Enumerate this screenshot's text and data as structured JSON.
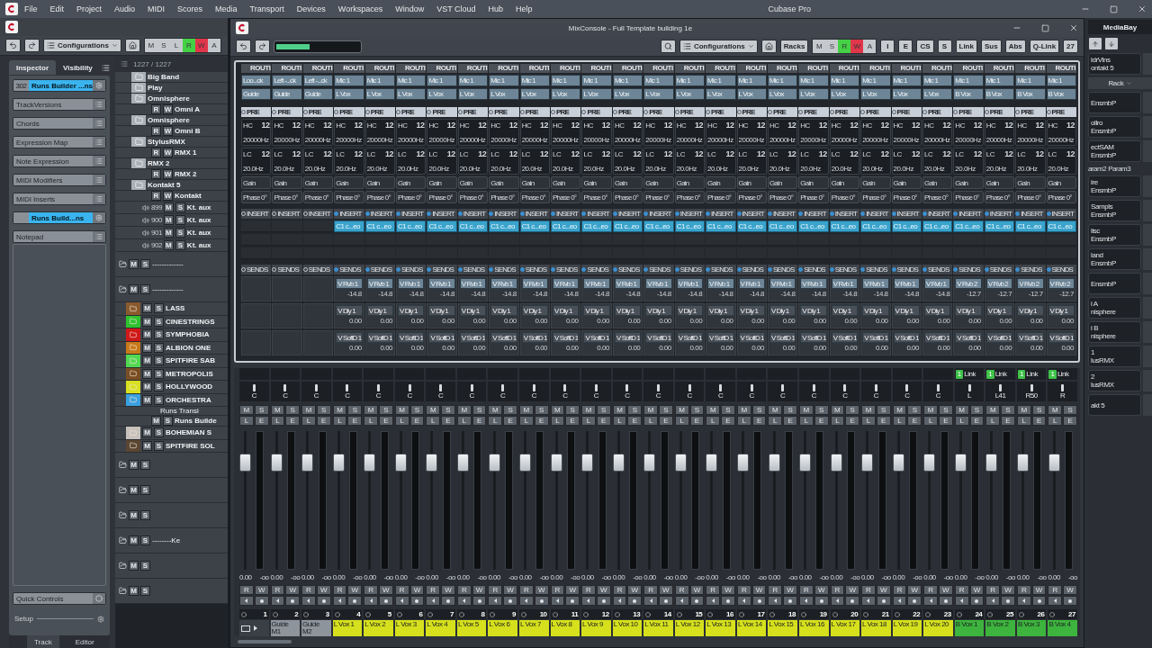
{
  "menu": {
    "items": [
      "File",
      "Edit",
      "Project",
      "Audio",
      "MIDI",
      "Scores",
      "Media",
      "Transport",
      "Devices",
      "Workspaces",
      "Window",
      "VST Cloud",
      "Hub",
      "Help"
    ],
    "title": "Cubase Pro"
  },
  "project": {
    "toolbar": {
      "config": "Configurations",
      "modes": [
        {
          "label": "M",
          "on": false
        },
        {
          "label": "S",
          "on": false
        },
        {
          "label": "L",
          "on": false
        },
        {
          "label": "R",
          "on": true,
          "color": "#45d145"
        },
        {
          "label": "W",
          "on": true,
          "color": "#e0364a"
        },
        {
          "label": "A",
          "on": false
        }
      ]
    },
    "tabs": [
      {
        "label": "Inspector",
        "selected": true
      },
      {
        "label": "Visibility",
        "selected": false
      }
    ],
    "inspector": [
      {
        "kind": "track",
        "number": "302",
        "label": "Runs Builder ...ns"
      },
      {
        "kind": "section",
        "label": "TrackVersions"
      },
      {
        "kind": "section",
        "label": "Chords"
      },
      {
        "kind": "section",
        "label": "Expression Map"
      },
      {
        "kind": "section",
        "label": "Note Expression"
      },
      {
        "kind": "section",
        "label": "MIDI Modifiers"
      },
      {
        "kind": "section",
        "label": "MIDI Inserts"
      },
      {
        "kind": "track",
        "label": "Runs Build...ns"
      },
      {
        "kind": "section",
        "label": "Notepad"
      }
    ],
    "quick_controls": "Quick Controls",
    "setup": "Setup",
    "track_count": "1227 / 1227",
    "tracks": [
      {
        "kind": "folder",
        "name": "Big Band"
      },
      {
        "kind": "folder",
        "name": "Play"
      },
      {
        "kind": "folder",
        "name": "Omnisphere",
        "children": [
          {
            "kind": "instrument",
            "name": "Omni A",
            "buttons": [
              "R",
              "W"
            ]
          }
        ]
      },
      {
        "kind": "folder",
        "name": "Omnisphere",
        "children": [
          {
            "kind": "instrument",
            "name": "Omni B",
            "buttons": [
              "R",
              "W"
            ]
          }
        ]
      },
      {
        "kind": "folder",
        "name": "StylusRMX",
        "children": [
          {
            "kind": "instrument",
            "name": "RMX 1",
            "buttons": [
              "R",
              "W"
            ]
          }
        ]
      },
      {
        "kind": "folder",
        "name": "RMX 2",
        "children": [
          {
            "kind": "instrument",
            "name": "RMX 2",
            "buttons": [
              "R",
              "W"
            ]
          }
        ]
      },
      {
        "kind": "folder",
        "name": "Kontakt 5",
        "children": [
          {
            "kind": "instrument",
            "name": "Kontakt",
            "buttons": [
              "R",
              "W"
            ]
          },
          {
            "kind": "output",
            "number": "899",
            "name": "Kt. aux",
            "buttons": [
              "M",
              "S"
            ]
          },
          {
            "kind": "output",
            "number": "900",
            "name": "Kt. aux",
            "buttons": [
              "M",
              "S"
            ]
          },
          {
            "kind": "output",
            "number": "901",
            "name": "Kt. aux",
            "buttons": [
              "M",
              "S"
            ]
          },
          {
            "kind": "output",
            "number": "902",
            "name": "Kt. aux",
            "buttons": [
              "M",
              "S"
            ]
          }
        ]
      },
      {
        "kind": "group",
        "name": "-------------",
        "buttons": [
          "M",
          "S"
        ]
      },
      {
        "kind": "group",
        "name": "-------------",
        "buttons": [
          "M",
          "S"
        ]
      },
      {
        "kind": "colored",
        "name": "LASS",
        "color": "#8a5a2e",
        "buttons": [
          "M",
          "S"
        ]
      },
      {
        "kind": "colored",
        "name": "CINESTRINGS",
        "color": "#2fc42f",
        "buttons": [
          "M",
          "S"
        ]
      },
      {
        "kind": "colored",
        "name": "SYMPHOBIA",
        "color": "#d01818",
        "buttons": [
          "M",
          "S"
        ]
      },
      {
        "kind": "colored",
        "name": "ALBION ONE",
        "color": "#c87a1a",
        "buttons": [
          "M",
          "S"
        ]
      },
      {
        "kind": "colored",
        "name": "SPITFIRE SAB",
        "color": "#52d852",
        "buttons": [
          "M",
          "S"
        ]
      },
      {
        "kind": "colored",
        "name": "METROPOLIS",
        "color": "#7a4e22",
        "buttons": [
          "M",
          "S"
        ]
      },
      {
        "kind": "colored",
        "name": "HOLLYWOOD",
        "color": "#d8e020",
        "buttons": [
          "M",
          "S"
        ]
      },
      {
        "kind": "colored",
        "name": "ORCHESTRA",
        "color": "#3aa0e0",
        "buttons": [
          "M",
          "S"
        ],
        "children": [
          {
            "kind": "label",
            "name": "Runs Transi"
          },
          {
            "kind": "instrument",
            "name": "Runs Builde",
            "buttons": [
              "M",
              "S"
            ]
          }
        ]
      },
      {
        "kind": "colored",
        "name": "BOHEMIAN S",
        "color": "#c8c2bc",
        "buttons": [
          "M",
          "S"
        ]
      },
      {
        "kind": "colored",
        "name": "SPITFIRE SOL",
        "color": "#5a4632",
        "buttons": [
          "M",
          "S"
        ]
      },
      {
        "kind": "group",
        "buttons": [
          "M",
          "S"
        ]
      },
      {
        "kind": "group",
        "buttons": [
          "M",
          "S"
        ]
      },
      {
        "kind": "group",
        "buttons": [
          "M",
          "S"
        ]
      },
      {
        "kind": "group",
        "name": "--------Ke",
        "buttons": [
          "M",
          "S"
        ]
      },
      {
        "kind": "group",
        "buttons": [
          "M",
          "S"
        ]
      },
      {
        "kind": "group",
        "buttons": [
          "M",
          "S"
        ]
      }
    ],
    "bottom_tabs": [
      {
        "label": "Track",
        "selected": true
      },
      {
        "label": "Editor",
        "selected": false
      }
    ]
  },
  "mixconsole": {
    "title": "MixConsole - Full Template building 1e",
    "toolbar": {
      "config": "Configurations",
      "racks": "Racks",
      "modes": [
        {
          "label": "M",
          "on": false
        },
        {
          "label": "S",
          "on": false
        },
        {
          "label": "R",
          "on": true,
          "color": "#45d145"
        },
        {
          "label": "W",
          "on": true,
          "color": "#e0364a"
        },
        {
          "label": "A",
          "on": false
        }
      ],
      "filters": [
        "I",
        "E",
        "CS",
        "S"
      ],
      "link": "Link",
      "sus": "Sus",
      "abs": "Abs",
      "qlink": "Q-Link",
      "count": "27"
    },
    "channels": [
      {
        "number": "1",
        "route_head": "ROUTI",
        "input": "Loo...ck",
        "output": "Guide",
        "pre": "PRE",
        "hc": "HC",
        "hc_slope": "12",
        "hc_freq": "20000Hz",
        "lc": "LC",
        "lc_slope": "12",
        "lc_freq": "20.0Hz",
        "gain": "Gain",
        "phase": "Phase 0°",
        "insert_head": "INSERT",
        "insert_on": false,
        "sends_head": "SENDS",
        "pan": "C",
        "buttons": [
          "M",
          "S",
          "L",
          "E"
        ],
        "rw": [
          "R",
          "W"
        ],
        "level": 0.77,
        "volume": "0.00",
        "peak": "-oo"
      },
      {
        "number": "2",
        "name": "Guide M1",
        "color": "#8d949c",
        "route_head": "ROUTI",
        "input": "Left -...ck",
        "output": "Guide",
        "pre": "PRE",
        "hc": "HC",
        "hc_slope": "12",
        "hc_freq": "20000Hz",
        "lc": "LC",
        "lc_slope": "12",
        "lc_freq": "20.0Hz",
        "gain": "Gain",
        "phase": "Phase 0°",
        "insert_head": "INSERT",
        "insert_on": false,
        "sends_head": "SENDS",
        "pan": "C",
        "buttons": [
          "M",
          "S",
          "L",
          "E"
        ],
        "rw": [
          "R",
          "W"
        ],
        "level": 0.77,
        "volume": "0.00",
        "peak": "-oo"
      },
      {
        "number": "3",
        "name": "Guide M2",
        "color": "#8d949c",
        "route_head": "ROUTI",
        "input": "Left -...ck",
        "output": "Guide",
        "pre": "PRE",
        "hc": "HC",
        "hc_slope": "12",
        "hc_freq": "20000Hz",
        "lc": "LC",
        "lc_slope": "12",
        "lc_freq": "20.0Hz",
        "gain": "Gain",
        "phase": "Phase 0°",
        "insert_head": "INSERT",
        "insert_on": false,
        "sends_head": "SENDS",
        "pan": "C",
        "buttons": [
          "M",
          "S",
          "L",
          "E"
        ],
        "rw": [
          "R",
          "W"
        ],
        "level": 0.77,
        "volume": "0.00",
        "peak": "-oo"
      },
      {
        "number": "4",
        "name": "L Vox 1",
        "color": "#d6e01c",
        "route_head": "ROUTI",
        "input": "Mic 1",
        "output": "L Vox",
        "pre": "PRE",
        "hc": "HC",
        "hc_slope": "12",
        "hc_freq": "20000Hz",
        "lc": "LC",
        "lc_slope": "12",
        "lc_freq": "20.0Hz",
        "gain": "Gain",
        "phase": "Phase 0°",
        "insert_head": "INSERT",
        "insert_on": true,
        "insert": "C1 c...eo",
        "sends_head": "SENDS",
        "sends": [
          {
            "name": "V Rvb 1",
            "value": "-14.8"
          },
          {
            "name": "V Dly 1",
            "value": "0.00"
          },
          {
            "name": "V SoftD 1",
            "value": "0.00"
          }
        ],
        "pan": "C",
        "buttons": [
          "M",
          "S",
          "L",
          "E"
        ],
        "rw": [
          "R",
          "W"
        ],
        "level": 0.77,
        "volume": "0.00",
        "peak": "-oo"
      },
      {
        "number": "5",
        "name": "L Vox 2",
        "color": "#d6e01c",
        "route_head": "ROUTI",
        "input": "Mic 1",
        "output": "L Vox",
        "pre": "PRE",
        "hc": "HC",
        "hc_slope": "12",
        "hc_freq": "20000Hz",
        "lc": "LC",
        "lc_slope": "12",
        "lc_freq": "20.0Hz",
        "gain": "Gain",
        "phase": "Phase 0°",
        "insert_head": "INSERT",
        "insert_on": true,
        "insert": "C1 c...eo",
        "sends_head": "SENDS",
        "sends": [
          {
            "name": "V Rvb 1",
            "value": "-14.8"
          },
          {
            "name": "V Dly 1",
            "value": "0.00"
          },
          {
            "name": "V SoftD 1",
            "value": "0.00"
          }
        ],
        "pan": "C",
        "buttons": [
          "M",
          "S",
          "L",
          "E"
        ],
        "rw": [
          "R",
          "W"
        ],
        "level": 0.77,
        "volume": "0.00",
        "peak": "-oo"
      },
      {
        "number": "6",
        "name": "L Vox 3",
        "color": "#d6e01c",
        "route_head": "ROUTI",
        "input": "Mic 1",
        "output": "L Vox",
        "pre": "PRE",
        "hc": "HC",
        "hc_slope": "12",
        "hc_freq": "20000Hz",
        "lc": "LC",
        "lc_slope": "12",
        "lc_freq": "20.0Hz",
        "gain": "Gain",
        "phase": "Phase 0°",
        "insert_head": "INSERT",
        "insert_on": true,
        "insert": "C1 c...eo",
        "sends_head": "SENDS",
        "sends": [
          {
            "name": "V Rvb 1",
            "value": "-14.8"
          },
          {
            "name": "V Dly 1",
            "value": "0.00"
          },
          {
            "name": "V SoftD 1",
            "value": "0.00"
          }
        ],
        "pan": "C",
        "buttons": [
          "M",
          "S",
          "L",
          "E"
        ],
        "rw": [
          "R",
          "W"
        ],
        "level": 0.77,
        "volume": "0.00",
        "peak": "-oo"
      },
      {
        "number": "7",
        "name": "L Vox 4",
        "color": "#d6e01c",
        "route_head": "ROUTI",
        "input": "Mic 1",
        "output": "L Vox",
        "pre": "PRE",
        "hc": "HC",
        "hc_slope": "12",
        "hc_freq": "20000Hz",
        "lc": "LC",
        "lc_slope": "12",
        "lc_freq": "20.0Hz",
        "gain": "Gain",
        "phase": "Phase 0°",
        "insert_head": "INSERT",
        "insert_on": true,
        "insert": "C1 c...eo",
        "sends_head": "SENDS",
        "sends": [
          {
            "name": "V Rvb 1",
            "value": "-14.8"
          },
          {
            "name": "V Dly 1",
            "value": "0.00"
          },
          {
            "name": "V SoftD 1",
            "value": "0.00"
          }
        ],
        "pan": "C",
        "buttons": [
          "M",
          "S",
          "L",
          "E"
        ],
        "rw": [
          "R",
          "W"
        ],
        "level": 0.77,
        "volume": "0.00",
        "peak": "-oo"
      },
      {
        "number": "8",
        "name": "L Vox 5",
        "color": "#d6e01c",
        "route_head": "ROUTI",
        "input": "Mic 1",
        "output": "L Vox",
        "pre": "PRE",
        "hc": "HC",
        "hc_slope": "12",
        "hc_freq": "20000Hz",
        "lc": "LC",
        "lc_slope": "12",
        "lc_freq": "20.0Hz",
        "gain": "Gain",
        "phase": "Phase 0°",
        "insert_head": "INSERT",
        "insert_on": true,
        "insert": "C1 c...eo",
        "sends_head": "SENDS",
        "sends": [
          {
            "name": "V Rvb 1",
            "value": "-14.8"
          },
          {
            "name": "V Dly 1",
            "value": "0.00"
          },
          {
            "name": "V SoftD 1",
            "value": "0.00"
          }
        ],
        "pan": "C",
        "buttons": [
          "M",
          "S",
          "L",
          "E"
        ],
        "rw": [
          "R",
          "W"
        ],
        "level": 0.77,
        "volume": "0.00",
        "peak": "-oo"
      },
      {
        "number": "9",
        "name": "L Vox 6",
        "color": "#d6e01c",
        "route_head": "ROUTI",
        "input": "Mic 1",
        "output": "L Vox",
        "pre": "PRE",
        "hc": "HC",
        "hc_slope": "12",
        "hc_freq": "20000Hz",
        "lc": "LC",
        "lc_slope": "12",
        "lc_freq": "20.0Hz",
        "gain": "Gain",
        "phase": "Phase 0°",
        "insert_head": "INSERT",
        "insert_on": true,
        "insert": "C1 c...eo",
        "sends_head": "SENDS",
        "sends": [
          {
            "name": "V Rvb 1",
            "value": "-14.8"
          },
          {
            "name": "V Dly 1",
            "value": "0.00"
          },
          {
            "name": "V SoftD 1",
            "value": "0.00"
          }
        ],
        "pan": "C",
        "buttons": [
          "M",
          "S",
          "L",
          "E"
        ],
        "rw": [
          "R",
          "W"
        ],
        "level": 0.77,
        "volume": "0.00",
        "peak": "-oo"
      },
      {
        "number": "10",
        "name": "L Vox 7",
        "color": "#d6e01c",
        "route_head": "ROUTI",
        "input": "Mic 1",
        "output": "L Vox",
        "pre": "PRE",
        "hc": "HC",
        "hc_slope": "12",
        "hc_freq": "20000Hz",
        "lc": "LC",
        "lc_slope": "12",
        "lc_freq": "20.0Hz",
        "gain": "Gain",
        "phase": "Phase 0°",
        "insert_head": "INSERT",
        "insert_on": true,
        "insert": "C1 c...eo",
        "sends_head": "SENDS",
        "sends": [
          {
            "name": "V Rvb 1",
            "value": "-14.8"
          },
          {
            "name": "V Dly 1",
            "value": "0.00"
          },
          {
            "name": "V SoftD 1",
            "value": "0.00"
          }
        ],
        "pan": "C",
        "buttons": [
          "M",
          "S",
          "L",
          "E"
        ],
        "rw": [
          "R",
          "W"
        ],
        "level": 0.77,
        "volume": "0.00",
        "peak": "-oo"
      },
      {
        "number": "11",
        "name": "L Vox 8",
        "color": "#d6e01c",
        "route_head": "ROUTI",
        "input": "Mic 1",
        "output": "L Vox",
        "pre": "PRE",
        "hc": "HC",
        "hc_slope": "12",
        "hc_freq": "20000Hz",
        "lc": "LC",
        "lc_slope": "12",
        "lc_freq": "20.0Hz",
        "gain": "Gain",
        "phase": "Phase 0°",
        "insert_head": "INSERT",
        "insert_on": true,
        "insert": "C1 c...eo",
        "sends_head": "SENDS",
        "sends": [
          {
            "name": "V Rvb 1",
            "value": "-14.8"
          },
          {
            "name": "V Dly 1",
            "value": "0.00"
          },
          {
            "name": "V SoftD 1",
            "value": "0.00"
          }
        ],
        "pan": "C",
        "buttons": [
          "M",
          "S",
          "L",
          "E"
        ],
        "rw": [
          "R",
          "W"
        ],
        "level": 0.77,
        "volume": "0.00",
        "peak": "-oo"
      },
      {
        "number": "12",
        "name": "L Vox 9",
        "color": "#d6e01c",
        "route_head": "ROUTI",
        "input": "Mic 1",
        "output": "L Vox",
        "pre": "PRE",
        "hc": "HC",
        "hc_slope": "12",
        "hc_freq": "20000Hz",
        "lc": "LC",
        "lc_slope": "12",
        "lc_freq": "20.0Hz",
        "gain": "Gain",
        "phase": "Phase 0°",
        "insert_head": "INSERT",
        "insert_on": true,
        "insert": "C1 c...eo",
        "sends_head": "SENDS",
        "sends": [
          {
            "name": "V Rvb 1",
            "value": "-14.8"
          },
          {
            "name": "V Dly 1",
            "value": "0.00"
          },
          {
            "name": "V SoftD 1",
            "value": "0.00"
          }
        ],
        "pan": "C",
        "buttons": [
          "M",
          "S",
          "L",
          "E"
        ],
        "rw": [
          "R",
          "W"
        ],
        "level": 0.77,
        "volume": "0.00",
        "peak": "-oo"
      },
      {
        "number": "13",
        "name": "L Vox 10",
        "color": "#d6e01c",
        "route_head": "ROUTI",
        "input": "Mic 1",
        "output": "L Vox",
        "pre": "PRE",
        "hc": "HC",
        "hc_slope": "12",
        "hc_freq": "20000Hz",
        "lc": "LC",
        "lc_slope": "12",
        "lc_freq": "20.0Hz",
        "gain": "Gain",
        "phase": "Phase 0°",
        "insert_head": "INSERT",
        "insert_on": true,
        "insert": "C1 c...eo",
        "sends_head": "SENDS",
        "sends": [
          {
            "name": "V Rvb 1",
            "value": "-14.8"
          },
          {
            "name": "V Dly 1",
            "value": "0.00"
          },
          {
            "name": "V SoftD 1",
            "value": "0.00"
          }
        ],
        "pan": "C",
        "buttons": [
          "M",
          "S",
          "L",
          "E"
        ],
        "rw": [
          "R",
          "W"
        ],
        "level": 0.77,
        "volume": "0.00",
        "peak": "-oo"
      },
      {
        "number": "14",
        "name": "L Vox 11",
        "color": "#d6e01c",
        "route_head": "ROUTI",
        "input": "Mic 1",
        "output": "L Vox",
        "pre": "PRE",
        "hc": "HC",
        "hc_slope": "12",
        "hc_freq": "20000Hz",
        "lc": "LC",
        "lc_slope": "12",
        "lc_freq": "20.0Hz",
        "gain": "Gain",
        "phase": "Phase 0°",
        "insert_head": "INSERT",
        "insert_on": true,
        "insert": "C1 c...eo",
        "sends_head": "SENDS",
        "sends": [
          {
            "name": "V Rvb 1",
            "value": "-14.8"
          },
          {
            "name": "V Dly 1",
            "value": "0.00"
          },
          {
            "name": "V SoftD 1",
            "value": "0.00"
          }
        ],
        "pan": "C",
        "buttons": [
          "M",
          "S",
          "L",
          "E"
        ],
        "rw": [
          "R",
          "W"
        ],
        "level": 0.77,
        "volume": "0.00",
        "peak": "-oo"
      },
      {
        "number": "15",
        "name": "L Vox 12",
        "color": "#d6e01c",
        "route_head": "ROUTI",
        "input": "Mic 1",
        "output": "L Vox",
        "pre": "PRE",
        "hc": "HC",
        "hc_slope": "12",
        "hc_freq": "20000Hz",
        "lc": "LC",
        "lc_slope": "12",
        "lc_freq": "20.0Hz",
        "gain": "Gain",
        "phase": "Phase 0°",
        "insert_head": "INSERT",
        "insert_on": true,
        "insert": "C1 c...eo",
        "sends_head": "SENDS",
        "sends": [
          {
            "name": "V Rvb 1",
            "value": "-14.8"
          },
          {
            "name": "V Dly 1",
            "value": "0.00"
          },
          {
            "name": "V SoftD 1",
            "value": "0.00"
          }
        ],
        "pan": "C",
        "buttons": [
          "M",
          "S",
          "L",
          "E"
        ],
        "rw": [
          "R",
          "W"
        ],
        "level": 0.77,
        "volume": "0.00",
        "peak": "-oo"
      },
      {
        "number": "16",
        "name": "L Vox 13",
        "color": "#d6e01c",
        "route_head": "ROUTI",
        "input": "Mic 1",
        "output": "L Vox",
        "pre": "PRE",
        "hc": "HC",
        "hc_slope": "12",
        "hc_freq": "20000Hz",
        "lc": "LC",
        "lc_slope": "12",
        "lc_freq": "20.0Hz",
        "gain": "Gain",
        "phase": "Phase 0°",
        "insert_head": "INSERT",
        "insert_on": true,
        "insert": "C1 c...eo",
        "sends_head": "SENDS",
        "sends": [
          {
            "name": "V Rvb 1",
            "value": "-14.8"
          },
          {
            "name": "V Dly 1",
            "value": "0.00"
          },
          {
            "name": "V SoftD 1",
            "value": "0.00"
          }
        ],
        "pan": "C",
        "buttons": [
          "M",
          "S",
          "L",
          "E"
        ],
        "rw": [
          "R",
          "W"
        ],
        "level": 0.77,
        "volume": "0.00",
        "peak": "-oo"
      },
      {
        "number": "17",
        "name": "L Vox 14",
        "color": "#d6e01c",
        "route_head": "ROUTI",
        "input": "Mic 1",
        "output": "L Vox",
        "pre": "PRE",
        "hc": "HC",
        "hc_slope": "12",
        "hc_freq": "20000Hz",
        "lc": "LC",
        "lc_slope": "12",
        "lc_freq": "20.0Hz",
        "gain": "Gain",
        "phase": "Phase 0°",
        "insert_head": "INSERT",
        "insert_on": true,
        "insert": "C1 c...eo",
        "sends_head": "SENDS",
        "sends": [
          {
            "name": "V Rvb 1",
            "value": "-14.8"
          },
          {
            "name": "V Dly 1",
            "value": "0.00"
          },
          {
            "name": "V SoftD 1",
            "value": "0.00"
          }
        ],
        "pan": "C",
        "buttons": [
          "M",
          "S",
          "L",
          "E"
        ],
        "rw": [
          "R",
          "W"
        ],
        "level": 0.77,
        "volume": "0.00",
        "peak": "-oo"
      },
      {
        "number": "18",
        "name": "L Vox 15",
        "color": "#d6e01c",
        "route_head": "ROUTI",
        "input": "Mic 1",
        "output": "L Vox",
        "pre": "PRE",
        "hc": "HC",
        "hc_slope": "12",
        "hc_freq": "20000Hz",
        "lc": "LC",
        "lc_slope": "12",
        "lc_freq": "20.0Hz",
        "gain": "Gain",
        "phase": "Phase 0°",
        "insert_head": "INSERT",
        "insert_on": true,
        "insert": "C1 c...eo",
        "sends_head": "SENDS",
        "sends": [
          {
            "name": "V Rvb 1",
            "value": "-14.8"
          },
          {
            "name": "V Dly 1",
            "value": "0.00"
          },
          {
            "name": "V SoftD 1",
            "value": "0.00"
          }
        ],
        "pan": "C",
        "buttons": [
          "M",
          "S",
          "L",
          "E"
        ],
        "rw": [
          "R",
          "W"
        ],
        "level": 0.77,
        "volume": "0.00",
        "peak": "-oo"
      },
      {
        "number": "19",
        "name": "L Vox 16",
        "color": "#d6e01c",
        "route_head": "ROUTI",
        "input": "Mic 1",
        "output": "L Vox",
        "pre": "PRE",
        "hc": "HC",
        "hc_slope": "12",
        "hc_freq": "20000Hz",
        "lc": "LC",
        "lc_slope": "12",
        "lc_freq": "20.0Hz",
        "gain": "Gain",
        "phase": "Phase 0°",
        "insert_head": "INSERT",
        "insert_on": true,
        "insert": "C1 c...eo",
        "sends_head": "SENDS",
        "sends": [
          {
            "name": "V Rvb 1",
            "value": "-14.8"
          },
          {
            "name": "V Dly 1",
            "value": "0.00"
          },
          {
            "name": "V SoftD 1",
            "value": "0.00"
          }
        ],
        "pan": "C",
        "buttons": [
          "M",
          "S",
          "L",
          "E"
        ],
        "rw": [
          "R",
          "W"
        ],
        "level": 0.77,
        "volume": "0.00",
        "peak": "-oo"
      },
      {
        "number": "20",
        "name": "L Vox 17",
        "color": "#d6e01c",
        "route_head": "ROUTI",
        "input": "Mic 1",
        "output": "L Vox",
        "pre": "PRE",
        "hc": "HC",
        "hc_slope": "12",
        "hc_freq": "20000Hz",
        "lc": "LC",
        "lc_slope": "12",
        "lc_freq": "20.0Hz",
        "gain": "Gain",
        "phase": "Phase 0°",
        "insert_head": "INSERT",
        "insert_on": true,
        "insert": "C1 c...eo",
        "sends_head": "SENDS",
        "sends": [
          {
            "name": "V Rvb 1",
            "value": "-14.8"
          },
          {
            "name": "V Dly 1",
            "value": "0.00"
          },
          {
            "name": "V SoftD 1",
            "value": "0.00"
          }
        ],
        "pan": "C",
        "buttons": [
          "M",
          "S",
          "L",
          "E"
        ],
        "rw": [
          "R",
          "W"
        ],
        "level": 0.77,
        "volume": "0.00",
        "peak": "-oo"
      },
      {
        "number": "21",
        "name": "L Vox 18",
        "color": "#d6e01c",
        "route_head": "ROUTI",
        "input": "Mic 1",
        "output": "L Vox",
        "pre": "PRE",
        "hc": "HC",
        "hc_slope": "12",
        "hc_freq": "20000Hz",
        "lc": "LC",
        "lc_slope": "12",
        "lc_freq": "20.0Hz",
        "gain": "Gain",
        "phase": "Phase 0°",
        "insert_head": "INSERT",
        "insert_on": true,
        "insert": "C1 c...eo",
        "sends_head": "SENDS",
        "sends": [
          {
            "name": "V Rvb 1",
            "value": "-14.8"
          },
          {
            "name": "V Dly 1",
            "value": "0.00"
          },
          {
            "name": "V SoftD 1",
            "value": "0.00"
          }
        ],
        "pan": "C",
        "buttons": [
          "M",
          "S",
          "L",
          "E"
        ],
        "rw": [
          "R",
          "W"
        ],
        "level": 0.77,
        "volume": "0.00",
        "peak": "-oo"
      },
      {
        "number": "22",
        "name": "L Vox 19",
        "color": "#d6e01c",
        "route_head": "ROUTI",
        "input": "Mic 1",
        "output": "L Vox",
        "pre": "PRE",
        "hc": "HC",
        "hc_slope": "12",
        "hc_freq": "20000Hz",
        "lc": "LC",
        "lc_slope": "12",
        "lc_freq": "20.0Hz",
        "gain": "Gain",
        "phase": "Phase 0°",
        "insert_head": "INSERT",
        "insert_on": true,
        "insert": "C1 c...eo",
        "sends_head": "SENDS",
        "sends": [
          {
            "name": "V Rvb 1",
            "value": "-14.8"
          },
          {
            "name": "V Dly 1",
            "value": "0.00"
          },
          {
            "name": "V SoftD 1",
            "value": "0.00"
          }
        ],
        "pan": "C",
        "buttons": [
          "M",
          "S",
          "L",
          "E"
        ],
        "rw": [
          "R",
          "W"
        ],
        "level": 0.77,
        "volume": "0.00",
        "peak": "-oo"
      },
      {
        "number": "23",
        "name": "L Vox 20",
        "color": "#d6e01c",
        "route_head": "ROUTI",
        "input": "Mic 1",
        "output": "L Vox",
        "pre": "PRE",
        "hc": "HC",
        "hc_slope": "12",
        "hc_freq": "20000Hz",
        "lc": "LC",
        "lc_slope": "12",
        "lc_freq": "20.0Hz",
        "gain": "Gain",
        "phase": "Phase 0°",
        "insert_head": "INSERT",
        "insert_on": true,
        "insert": "C1 c...eo",
        "sends_head": "SENDS",
        "sends": [
          {
            "name": "V Rvb 1",
            "value": "-14.8"
          },
          {
            "name": "V Dly 1",
            "value": "0.00"
          },
          {
            "name": "V SoftD 1",
            "value": "0.00"
          }
        ],
        "pan": "C",
        "buttons": [
          "M",
          "S",
          "L",
          "E"
        ],
        "rw": [
          "R",
          "W"
        ],
        "level": 0.77,
        "volume": "0.00",
        "peak": "-oo"
      },
      {
        "number": "24",
        "name": "B Vox 1",
        "color": "#3db43d",
        "route_head": "ROUTI",
        "input": "Mic 1",
        "output": "B Vox",
        "pre": "PRE",
        "hc": "HC",
        "hc_slope": "12",
        "hc_freq": "20000Hz",
        "lc": "LC",
        "lc_slope": "12",
        "lc_freq": "20.0Hz",
        "gain": "Gain",
        "phase": "Phase 0°",
        "insert_head": "INSERT",
        "insert_on": true,
        "insert": "C1 c...eo",
        "sends_head": "SENDS",
        "sends": [
          {
            "name": "V Rvb 2",
            "value": "-12.7"
          },
          {
            "name": "V Dly 1",
            "value": "0.00"
          },
          {
            "name": "V SoftD 1",
            "value": "0.00"
          }
        ],
        "pan": "L",
        "link": {
          "number": "1",
          "label": "Link"
        },
        "buttons": [
          "M",
          "S",
          "L",
          "E"
        ],
        "rw": [
          "R",
          "W"
        ],
        "level": 0.77,
        "volume": "0.00",
        "peak": "-oo"
      },
      {
        "number": "25",
        "name": "B Vox 2",
        "color": "#3db43d",
        "route_head": "ROUTI",
        "input": "Mic 1",
        "output": "B Vox",
        "pre": "PRE",
        "hc": "HC",
        "hc_slope": "12",
        "hc_freq": "20000Hz",
        "lc": "LC",
        "lc_slope": "12",
        "lc_freq": "20.0Hz",
        "gain": "Gain",
        "phase": "Phase 0°",
        "insert_head": "INSERT",
        "insert_on": true,
        "insert": "C1 c...eo",
        "sends_head": "SENDS",
        "sends": [
          {
            "name": "V Rvb 2",
            "value": "-12.7"
          },
          {
            "name": "V Dly 1",
            "value": "0.00"
          },
          {
            "name": "V SoftD 1",
            "value": "0.00"
          }
        ],
        "pan": "L41",
        "link": {
          "number": "1",
          "label": "Link"
        },
        "buttons": [
          "M",
          "S",
          "L",
          "E"
        ],
        "rw": [
          "R",
          "W"
        ],
        "level": 0.77,
        "volume": "0.00",
        "peak": "-oo"
      },
      {
        "number": "26",
        "name": "B Vox 3",
        "color": "#3db43d",
        "route_head": "ROUTI",
        "input": "Mic 1",
        "output": "B Vox",
        "pre": "PRE",
        "hc": "HC",
        "hc_slope": "12",
        "hc_freq": "20000Hz",
        "lc": "LC",
        "lc_slope": "12",
        "lc_freq": "20.0Hz",
        "gain": "Gain",
        "phase": "Phase 0°",
        "insert_head": "INSERT",
        "insert_on": true,
        "insert": "C1 c...eo",
        "sends_head": "SENDS",
        "sends": [
          {
            "name": "V Rvb 2",
            "value": "-12.7"
          },
          {
            "name": "V Dly 1",
            "value": "0.00"
          },
          {
            "name": "V SoftD 1",
            "value": "0.00"
          }
        ],
        "pan": "R50",
        "link": {
          "number": "1",
          "label": "Link"
        },
        "buttons": [
          "M",
          "S",
          "L",
          "E"
        ],
        "rw": [
          "R",
          "W"
        ],
        "level": 0.77,
        "volume": "0.00",
        "peak": "-oo"
      },
      {
        "number": "27",
        "name": "B Vox 4",
        "color": "#3db43d",
        "route_head": "ROUTI",
        "input": "Mic 1",
        "output": "B Vox",
        "pre": "PRE",
        "hc": "HC",
        "hc_slope": "12",
        "hc_freq": "20000Hz",
        "lc": "LC",
        "lc_slope": "12",
        "lc_freq": "20.0Hz",
        "gain": "Gain",
        "phase": "Phase 0°",
        "insert_head": "INSERT",
        "insert_on": true,
        "insert": "C1 c...eo",
        "sends_head": "SENDS",
        "sends": [
          {
            "name": "V Rvb 2",
            "value": "-12.7"
          },
          {
            "name": "V Dly 1",
            "value": "0.00"
          },
          {
            "name": "V SoftD 1",
            "value": "0.00"
          }
        ],
        "pan": "R",
        "link": {
          "number": "1",
          "label": "Link"
        },
        "buttons": [
          "M",
          "S",
          "L",
          "E"
        ],
        "rw": [
          "R",
          "W"
        ],
        "level": 0.77,
        "volume": "0.00",
        "peak": "-oo"
      }
    ]
  },
  "right_panel": {
    "tab": "MediaBay",
    "rack": "Rack",
    "slots": [
      [
        "ldrVlns",
        "ontakt 5"
      ],
      [
        "EnsmbP"
      ],
      [
        "ollro",
        "EnsmbP"
      ],
      [
        "ectSAM",
        "EnsmbP"
      ],
      [
        "ire",
        "EnsmbP"
      ],
      [
        "Sampls",
        "EnsmbP"
      ],
      [
        "lisc",
        "EnsmbP"
      ],
      [
        "land",
        "EnsmbP"
      ],
      [
        "EnsmbP"
      ],
      [
        "i A",
        "nisphere"
      ],
      [
        "i B",
        "nisphere"
      ],
      [
        "1",
        "lusRMX"
      ],
      [
        "2",
        "lusRMX"
      ],
      [
        "akt 5"
      ]
    ],
    "params": [
      "aram2",
      "Param3"
    ]
  }
}
